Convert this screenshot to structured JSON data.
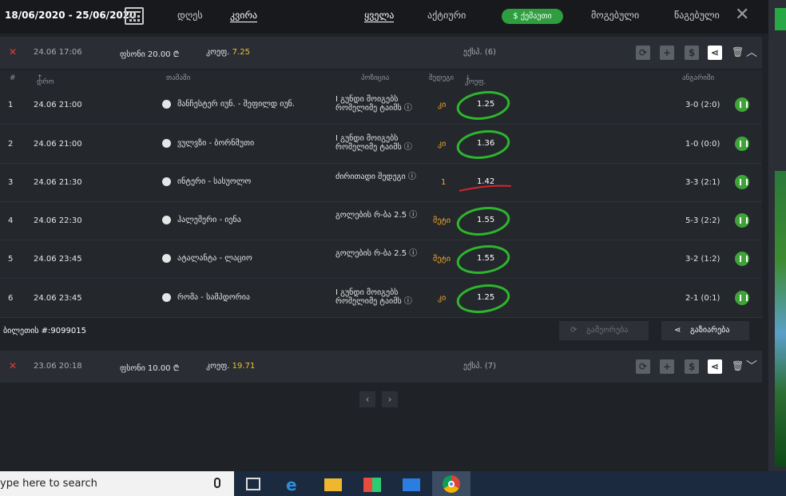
{
  "header": {
    "daterange": "18/06/2020 - 25/06/2020",
    "tabs_period": [
      "დღეს",
      "კვირა"
    ],
    "tabs_filter": [
      "ყველა",
      "აქტიური",
      "$ ქეშაუთი",
      "მოგებული",
      "წაგებული"
    ]
  },
  "ticket1": {
    "date": "24.06  17:06",
    "stake": "ფსონი 20.00 ₾",
    "coef_label": "კოეფ.",
    "coef": "7.25",
    "type": "ექსპ. (6)"
  },
  "table": {
    "headers": [
      "#",
      "დრო",
      "თამაში",
      "პოზიცია",
      "შედეგი",
      "კოეფ.",
      "ანგარიში"
    ],
    "rows": [
      {
        "num": "1",
        "time": "24.06  21:00",
        "match": "მანჩესტერ იუნ. - შეფილდ იუნ.",
        "pos": "I გუნდი მოიგებს რომელიმე ტაიმს ⓘ",
        "pick": "კი",
        "odds": "1.25",
        "score": "3-0 (2:0)"
      },
      {
        "num": "2",
        "time": "24.06  21:00",
        "match": "ვულვზი - ბორნმუთი",
        "pos": "I გუნდი მოიგებს რომელიმე ტაიმს ⓘ",
        "pick": "კი",
        "odds": "1.36",
        "score": "1-0 (0:0)"
      },
      {
        "num": "3",
        "time": "24.06  21:30",
        "match": "ინტერი - სასუოლო",
        "pos": "ძირითადი შედეგი ⓘ",
        "pick": "1",
        "odds": "1.42",
        "score": "3-3 (2:1)"
      },
      {
        "num": "4",
        "time": "24.06  22:30",
        "match": "ჰალეშერი - იენა",
        "pos": "გოლების რ-ბა 2.5 ⓘ",
        "pick": "მეტი",
        "odds": "1.55",
        "score": "5-3 (2:2)"
      },
      {
        "num": "5",
        "time": "24.06  23:45",
        "match": "ატალანტა - ლაციო",
        "pos": "გოლების რ-ბა 2.5 ⓘ",
        "pick": "მეტი",
        "odds": "1.55",
        "score": "3-2 (1:2)"
      },
      {
        "num": "6",
        "time": "24.06  23:45",
        "match": "რომა - სამპდორია",
        "pos": "I გუნდი მოიგებს რომელიმე ტაიმს ⓘ",
        "pick": "კი",
        "odds": "1.25",
        "score": "2-1 (0:1)"
      }
    ]
  },
  "footer": {
    "ticket_id": "ბილეთის #:9099015",
    "repeat": "გამეორება",
    "share": "გაზიარება"
  },
  "ticket2": {
    "date": "23.06  20:18",
    "stake": "ფსონი 10.00 ₾",
    "coef_label": "კოეფ.",
    "coef": "19.71",
    "type": "ექსპ. (7)"
  },
  "taskbar": {
    "search_placeholder": "ype here to search"
  },
  "colors": {
    "accent_green": "#2e9e3f",
    "coef_yellow": "#f0c02a",
    "lose_red": "#e23b3b"
  }
}
